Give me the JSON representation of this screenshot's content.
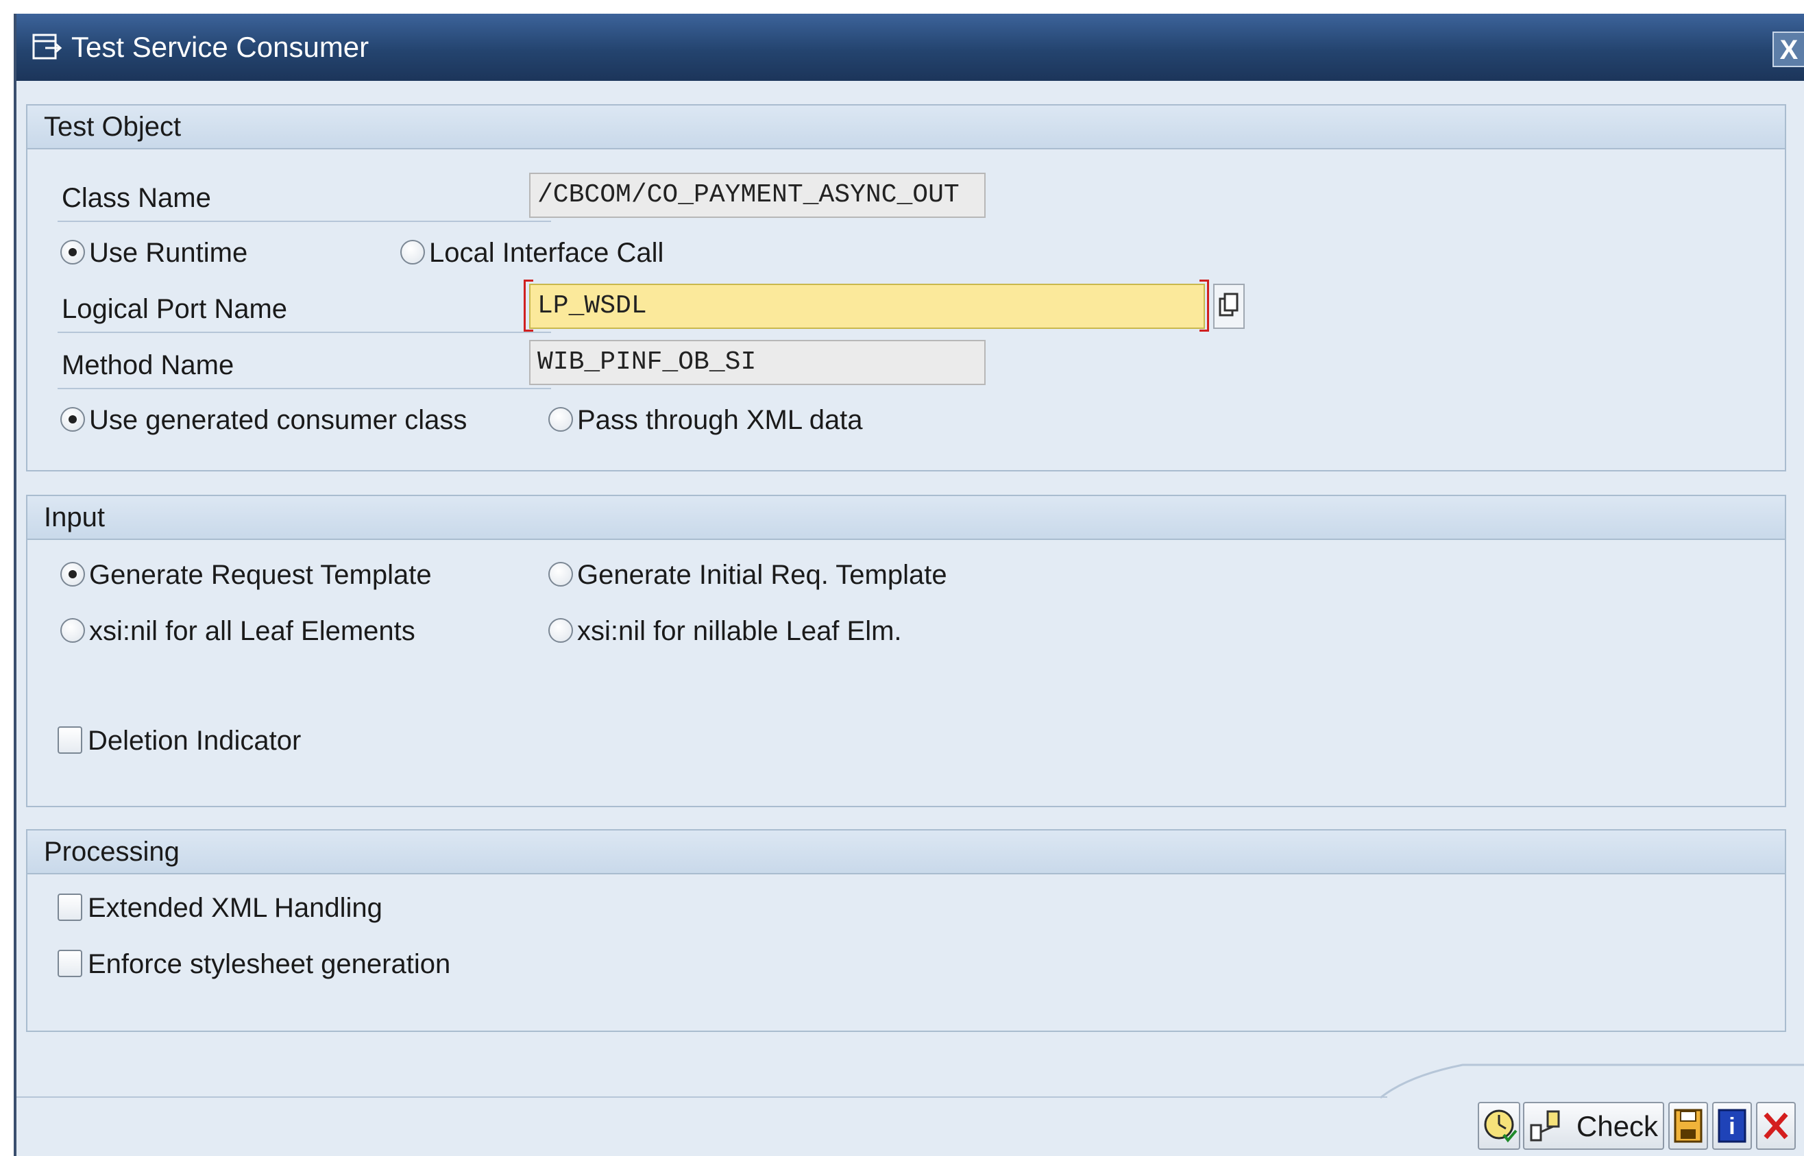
{
  "window": {
    "title": "Test Service Consumer",
    "close_label": "X"
  },
  "test_object": {
    "header": "Test Object",
    "class_name_label": "Class Name",
    "class_name_value": "/CBCOM/CO_PAYMENT_ASYNC_OUT",
    "runtime_options": [
      {
        "label": "Use Runtime",
        "checked": true
      },
      {
        "label": "Local Interface Call",
        "checked": false
      }
    ],
    "logical_port_label": "Logical Port Name",
    "logical_port_value": "LP_WSDL",
    "method_name_label": "Method Name",
    "method_name_value": "WIB_PINF_OB_SI",
    "consumer_options": [
      {
        "label": "Use generated consumer class",
        "checked": true
      },
      {
        "label": "Pass through XML data",
        "checked": false
      }
    ]
  },
  "input": {
    "header": "Input",
    "template_options": [
      {
        "label": "Generate Request Template",
        "checked": true
      },
      {
        "label": "Generate Initial Req. Template",
        "checked": false
      }
    ],
    "nil_options": [
      {
        "label": "xsi:nil for all Leaf Elements",
        "checked": false
      },
      {
        "label": "xsi:nil for nillable Leaf Elm.",
        "checked": false
      }
    ],
    "deletion_indicator": {
      "label": "Deletion Indicator",
      "checked": false
    }
  },
  "processing": {
    "header": "Processing",
    "extended_xml": {
      "label": "Extended XML Handling",
      "checked": false
    },
    "enforce_stylesheet": {
      "label": "Enforce stylesheet generation",
      "checked": false
    }
  },
  "toolbar": {
    "check_label": "Check",
    "buttons": [
      "execute-icon",
      "check-icon",
      "save-icon",
      "help-icon",
      "cancel-icon"
    ]
  },
  "colors": {
    "titlebar": "#24446f",
    "panel_bg": "#e3ebf4",
    "focused_field": "#fbe99b",
    "required_marker": "#d02020"
  }
}
